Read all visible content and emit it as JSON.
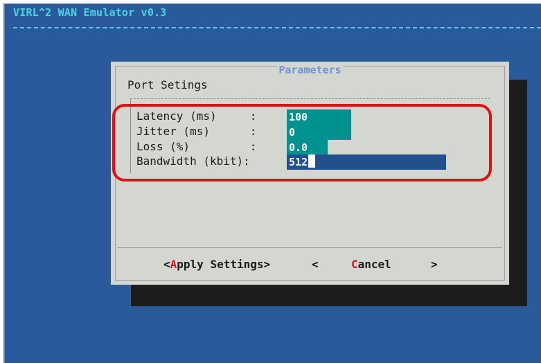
{
  "app": {
    "title": "VIRL^2 WAN Emulator v0.3"
  },
  "dialog": {
    "title": "Parameters",
    "section_label": "Port Setings",
    "fields": [
      {
        "label": "Latency (ms)     :",
        "value": "100"
      },
      {
        "label": "Jitter (ms)      :",
        "value": "0"
      },
      {
        "label": "Loss (%)         :",
        "value": "0.0"
      },
      {
        "label": "Bandwidth (kbit):",
        "value": "512"
      }
    ],
    "buttons": {
      "apply_open": "<",
      "apply_hotkey": "A",
      "apply_rest": "pply Settings>",
      "separator": "<",
      "cancel_hotkey": "C",
      "cancel_rest": "ancel",
      "close": ">"
    }
  },
  "colors": {
    "screen_bg": "#2a5a9b",
    "title_text": "#49d7de",
    "field_active": "#009191",
    "field_focused": "#22508f",
    "hotkey": "#d01818",
    "annotation": "#e01010"
  }
}
